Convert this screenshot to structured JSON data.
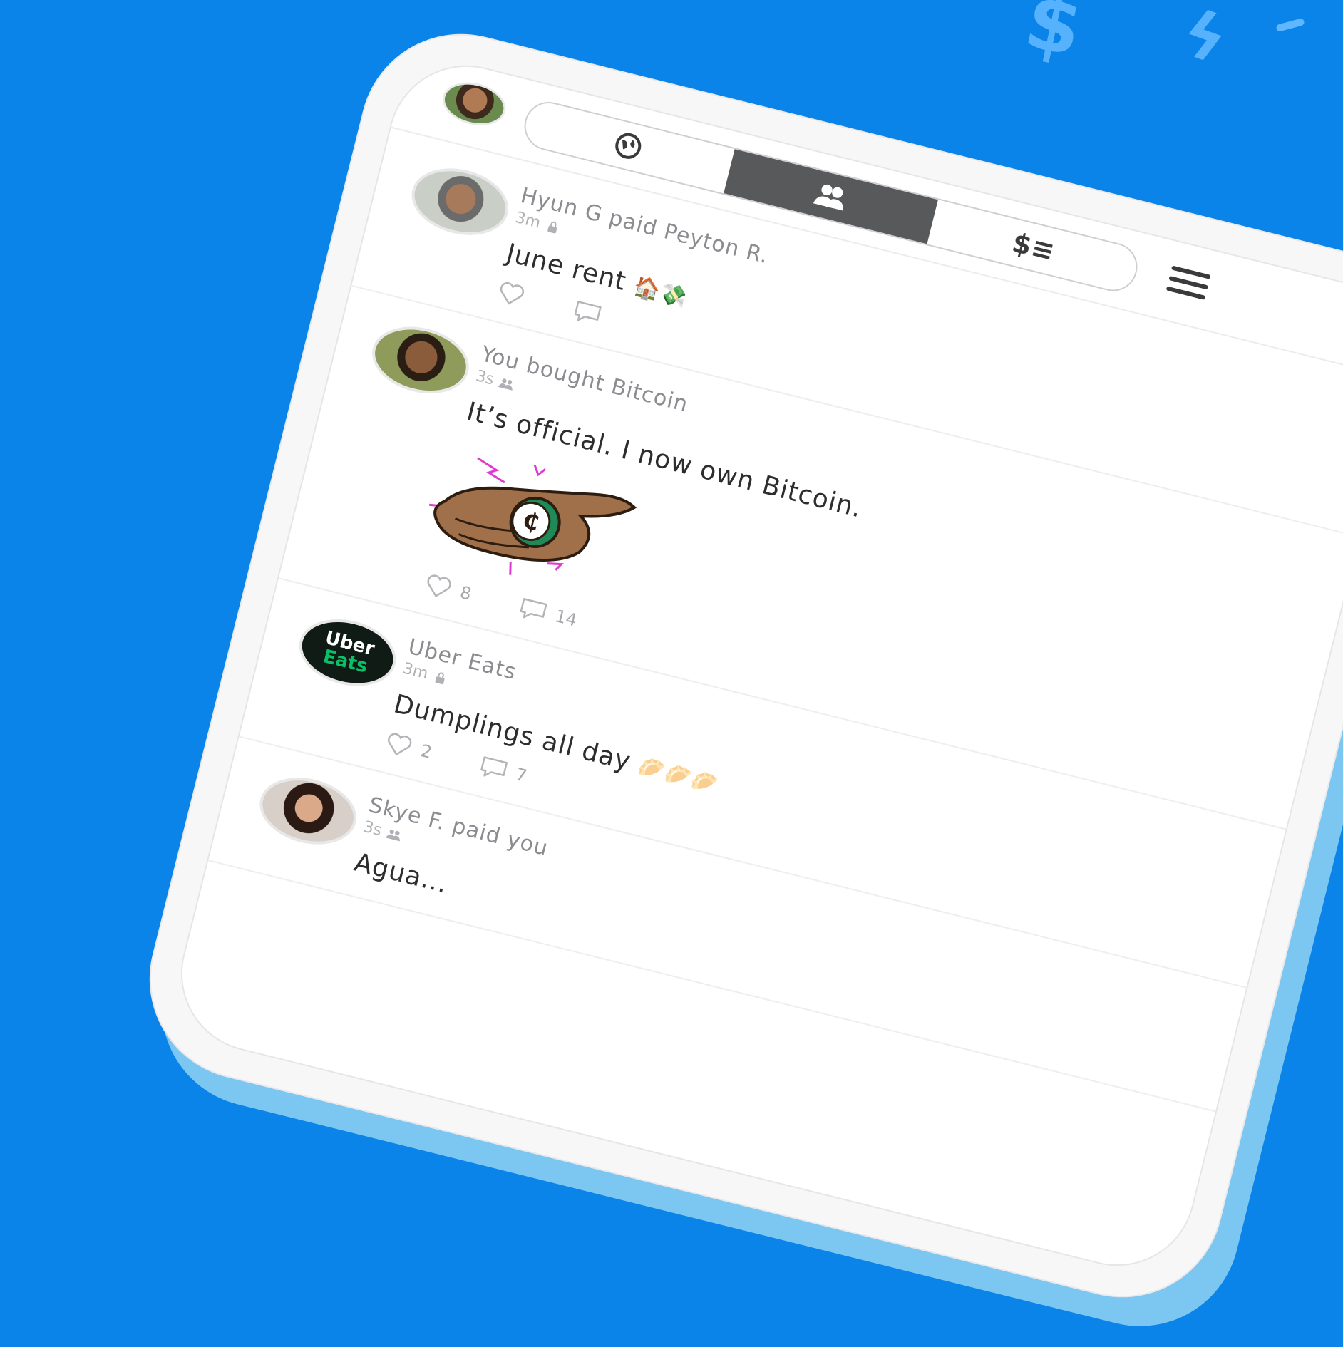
{
  "tabs": {
    "public_icon": "globe-icon",
    "friends_icon": "friends-icon",
    "personal_label": "$≡"
  },
  "menu_icon": "hamburger-menu-icon",
  "feed": [
    {
      "headline": "Hyun G paid Peyton R.",
      "time": "3m",
      "privacy_icon": "lock-icon",
      "note": "June rent",
      "emoji": "🏠💸",
      "likes": "",
      "comments": ""
    },
    {
      "headline": "You bought Bitcoin",
      "time": "3s",
      "privacy_icon": "friends-icon",
      "note": "It’s official. I now own Bitcoin.",
      "sticker": "hand-holding-bitcoin",
      "likes": "8",
      "comments": "14"
    },
    {
      "headline": "Uber Eats",
      "avatar_text_1": "Uber",
      "avatar_text_2": "Eats",
      "time": "3m",
      "privacy_icon": "lock-icon",
      "note": "Dumplings all day",
      "emoji": "🥟🥟🥟",
      "likes": "2",
      "comments": "7"
    },
    {
      "headline": "Skye F. paid you",
      "time": "3s",
      "privacy_icon": "friends-icon",
      "note": "Agua..."
    }
  ],
  "colors": {
    "background": "#0a84e8",
    "active_tab": "#58595b"
  }
}
